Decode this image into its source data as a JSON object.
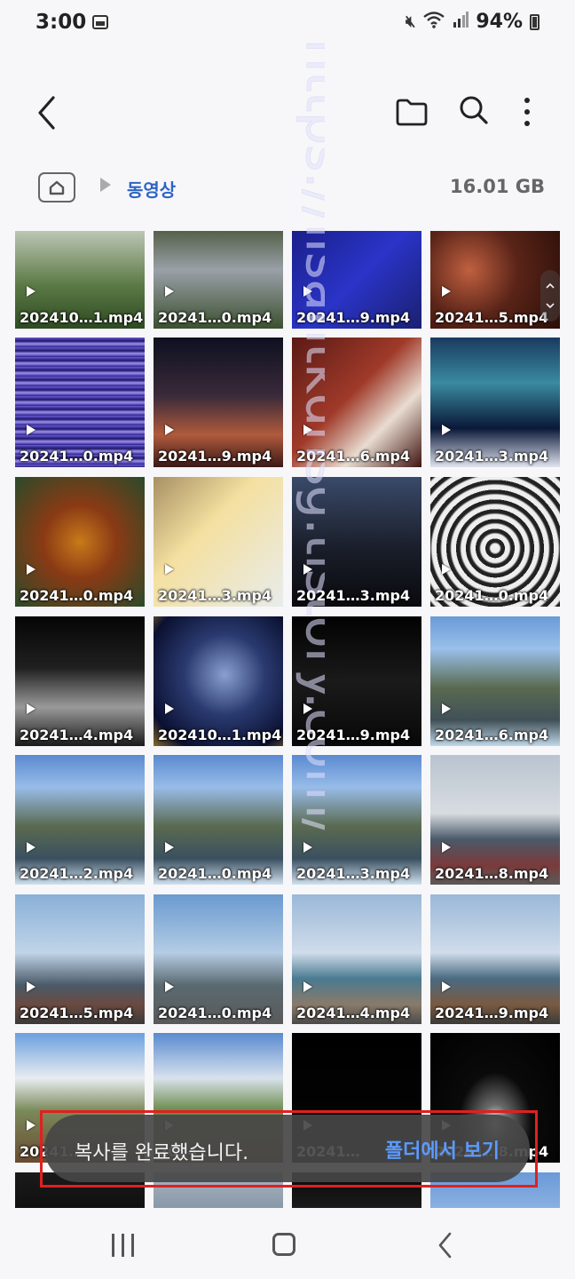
{
  "status": {
    "time": "3:00",
    "battery": "94%"
  },
  "breadcrumb": {
    "current": "동영상",
    "storage": "16.01 GB"
  },
  "thumbnails": [
    {
      "caption": "202410…1.mp4",
      "bg": "linear-gradient(180deg,#bcc6b4 0%,#5c7a46 55%,#2e4a22 100%)"
    },
    {
      "caption": "20241…0.mp4",
      "bg": "linear-gradient(180deg,#56604a 0%,#9aa0a8 40%,#3c5030 100%)"
    },
    {
      "caption": "20241…9.mp4",
      "bg": "linear-gradient(135deg,#1a1f8a 0%,#2a34c8 50%,#1b2070 100%)"
    },
    {
      "caption": "20241…5.mp4",
      "bg": "radial-gradient(circle at 30% 40%,#c06040 0%,#5a2418 45%,#2a0e08 100%)"
    },
    {
      "caption": "20241…0.mp4",
      "bg": "repeating-linear-gradient(180deg,#6a5ad8 0px,#1c1868 4px,#a090f0 7px,#2a208a 11px)"
    },
    {
      "caption": "20241…9.mp4",
      "bg": "linear-gradient(180deg,#0e1020 0%,#3a2a3a 45%,#b05a3c 75%,#3a1a18 100%)"
    },
    {
      "caption": "20241…6.mp4",
      "bg": "linear-gradient(135deg,#5a1a14 0%,#a03a2a 45%,#e8dcd0 70%,#401410 100%)"
    },
    {
      "caption": "20241…3.mp4",
      "bg": "linear-gradient(180deg,#1a3a60 0%,#3a8aa0 35%,#0a1838 70%,#e0e4f0 100%)"
    },
    {
      "caption": "20241…0.mp4",
      "bg": "radial-gradient(circle at 50% 50%,#c87a1a 0%,#8a3a14 40%,#2a4a2a 100%)"
    },
    {
      "caption": "20241…3.mp4",
      "bg": "linear-gradient(135deg,#a89064 0%,#f4e0a0 40%,#e8ecec 100%)"
    },
    {
      "caption": "20241…3.mp4",
      "bg": "linear-gradient(180deg,#3a4a6a 0%,#1a1e2a 55%,#0a0a0e 100%)"
    },
    {
      "caption": "20241…0.mp4",
      "bg": "repeating-radial-gradient(circle at 50% 55%,#eeeeee 0px,#eeeeee 5px,#222222 7px,#222222 11px)"
    },
    {
      "caption": "20241…4.mp4",
      "bg": "linear-gradient(180deg,#050505 0%,#202020 40%,#9a9a9a 70%,#1a1a1a 100%)"
    },
    {
      "caption": "202410…1.mp4",
      "bg": "radial-gradient(circle at 55% 45%,#8aa0d0 0%,#2a3a70 40%,#0a1030 80%,#8a6a2a 100%)"
    },
    {
      "caption": "20241…9.mp4",
      "bg": "linear-gradient(180deg,#020202 0%,#1a1a1a 50%,#080808 100%)"
    },
    {
      "caption": "20241…6.mp4",
      "bg": "linear-gradient(180deg,#6a9ad8 0%,#9ac0ea 25%,#5a6a50 55%,#405058 80%,#c0d8e8 100%)"
    },
    {
      "caption": "20241…2.mp4",
      "bg": "linear-gradient(180deg,#5a8ad0 0%,#98bce8 25%,#5a6a50 55%,#3a5060 80%,#d0e0ee 100%)"
    },
    {
      "caption": "20241…0.mp4",
      "bg": "linear-gradient(180deg,#5a8ad0 0%,#98bce8 25%,#5a6a50 55%,#3a5060 80%,#d0e0ee 100%)"
    },
    {
      "caption": "20241…3.mp4",
      "bg": "linear-gradient(180deg,#5a8ad0 0%,#98bce8 25%,#5a6a50 55%,#3a5060 80%,#d0e0ee 100%)"
    },
    {
      "caption": "20241…8.mp4",
      "bg": "linear-gradient(180deg,#b8c4d0 0%,#d8dce0 45%,#4a5a6a 65%,#7a3a3a 85%,#5a5a5a 100%)"
    },
    {
      "caption": "20241…5.mp4",
      "bg": "linear-gradient(180deg,#8ab0d8 0%,#c0d4e8 45%,#4a5a68 70%,#6a4a40 85%,#3a3a3a 100%)"
    },
    {
      "caption": "20241…0.mp4",
      "bg": "linear-gradient(180deg,#6a9ad0 0%,#b4cce4 45%,#5a6a70 70%,#5a5a5a 100%)"
    },
    {
      "caption": "20241…4.mp4",
      "bg": "linear-gradient(180deg,#9ab8d8 0%,#d0dcea 45%,#4a7a90 65%,#8a7a6a 85%,#4a4a4a 100%)"
    },
    {
      "caption": "20241…9.mp4",
      "bg": "linear-gradient(180deg,#9ab8d8 0%,#d0dcea 45%,#4a6a80 65%,#7a5a40 85%,#3a3a3a 100%)"
    },
    {
      "caption": "20241…",
      "bg": "linear-gradient(180deg,#6aa0e0 0%,#e8ecf0 35%,#7a8a5a 60%,#6a4a30 100%)"
    },
    {
      "caption": "20241…",
      "bg": "linear-gradient(180deg,#5a8ad0 0%,#d8e2ec 35%,#6a8a4a 60%,#7a5a3a 100%)"
    },
    {
      "caption": "20241…",
      "bg": "linear-gradient(180deg,#000000 0%,#050505 100%)"
    },
    {
      "caption": "20241…8.mp4",
      "bg": "radial-gradient(ellipse at 50% 70%,#f0f0f0 0%,#6a6a6a 15%,#0a0a0a 40%,#000000 100%)"
    },
    {
      "caption": "",
      "bg": "linear-gradient(180deg,#1a1a1a 0%,#101010 100%)"
    },
    {
      "caption": "",
      "bg": "linear-gradient(180deg,#aab4c0 0%,#8898a8 100%)"
    },
    {
      "caption": "",
      "bg": "linear-gradient(180deg,#0a0a0a 0%,#1a1a1a 100%)"
    },
    {
      "caption": "",
      "bg": "linear-gradient(180deg,#6a9ad8 0%,#8ab0e0 100%)"
    }
  ],
  "toast": {
    "message": "복사를 완료했습니다.",
    "action": "폴더에서 보기"
  },
  "watermark": {
    "text": "https://ilsantkdnsg.tistory.com/"
  }
}
